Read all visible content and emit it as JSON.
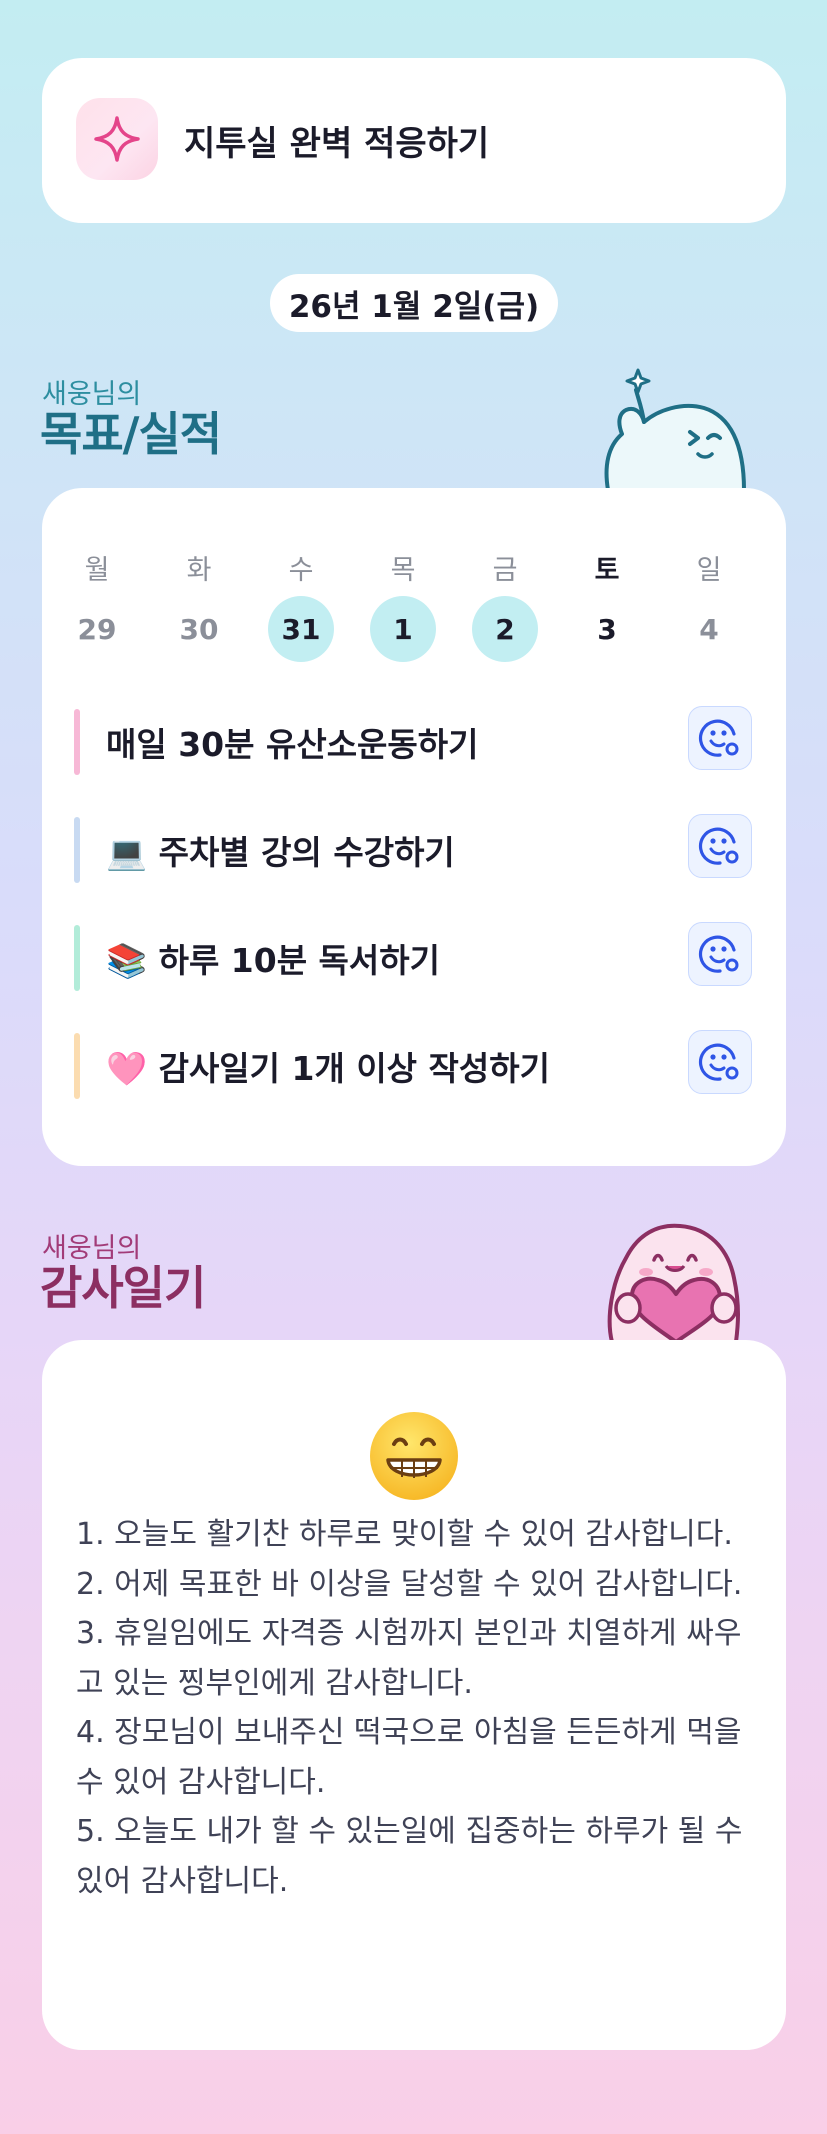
{
  "header": {
    "title": "지투실 완벽 적응하기",
    "icon": "sparkle-icon"
  },
  "date": "26년 1월 2일(금)",
  "goals_section": {
    "subtitle": "새웅님의",
    "title": "목표/실적"
  },
  "calendar": {
    "weekdays": [
      "월",
      "화",
      "수",
      "목",
      "금",
      "토",
      "일"
    ],
    "days": [
      "29",
      "30",
      "31",
      "1",
      "2",
      "3",
      "4"
    ],
    "completed_days": [
      "31",
      "1",
      "2"
    ]
  },
  "goals": [
    {
      "label": "매일 30분 유산소운동하기",
      "bar_color": "#f7b8d6"
    },
    {
      "label": "💻 주차별 강의 수강하기",
      "bar_color": "#c8daf2"
    },
    {
      "label": "📚 하루 10분 독서하기",
      "bar_color": "#b2ecd9"
    },
    {
      "label": "🩷 감사일기 1개 이상 작성하기",
      "bar_color": "#fbdcb0"
    }
  ],
  "diary_section": {
    "subtitle": "새웅님의",
    "title": "감사일기"
  },
  "diary": {
    "mood": "grinning-face-emoji",
    "entries": [
      "1. 오늘도 활기찬 하루로 맞이할 수 있어 감사합니다.",
      "2. 어제 목표한 바 이상을 달성할 수 있어 감사합니다.",
      "3. 휴일임에도 자격증 시험까지 본인과 치열하게 싸우고 있는 찡부인에게 감사합니다.",
      "4. 장모님이 보내주신 떡국으로 아침을 든든하게 먹을 수 있어 감사합니다.",
      "5. 오늘도 내가 할 수 있는일에 집중하는 하루가 될 수 있어 감사합니다."
    ]
  },
  "colors": {
    "accent_teal": "#1f6f86",
    "accent_pink": "#8c2f62",
    "button_blue": "#2f55e6"
  }
}
